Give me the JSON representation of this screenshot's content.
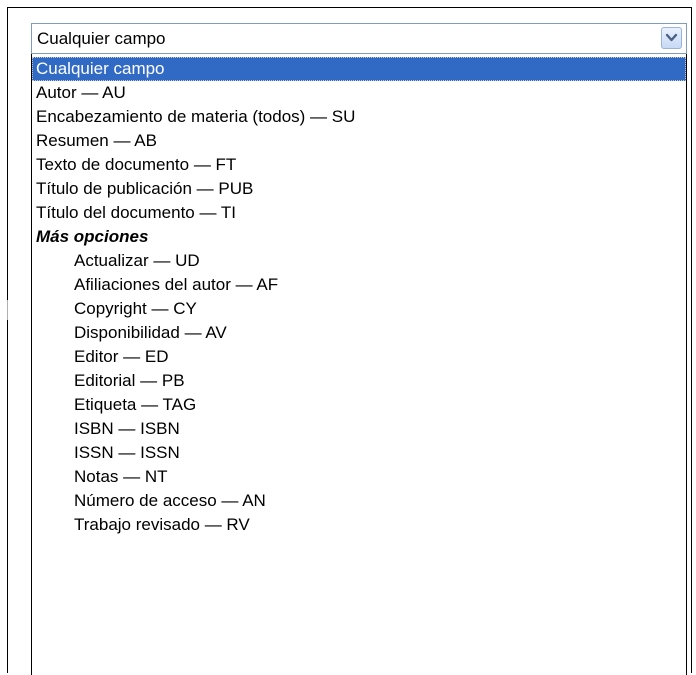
{
  "select": {
    "value": "Cualquier campo",
    "arrow_icon": "chevron-down-icon"
  },
  "options": {
    "cualquier_campo": "Cualquier campo",
    "autor": "Autor — AU",
    "encabezamiento": "Encabezamiento de materia (todos) — SU",
    "resumen": "Resumen — AB",
    "texto": "Texto de documento — FT",
    "titulo_publicacion": "Título de publicación — PUB",
    "titulo_documento": "Título del documento — TI"
  },
  "group": {
    "label": "Más opciones",
    "items": {
      "actualizar": "Actualizar — UD",
      "afiliaciones": "Afiliaciones del autor — AF",
      "copyright": "Copyright — CY",
      "disponibilidad": "Disponibilidad — AV",
      "editor": "Editor — ED",
      "editorial": "Editorial — PB",
      "etiqueta": "Etiqueta — TAG",
      "isbn": "ISBN — ISBN",
      "issn": "ISSN — ISSN",
      "notas": "Notas — NT",
      "numero_acceso": "Número de acceso — AN",
      "trabajo_revisado": "Trabajo revisado — RV"
    }
  },
  "colors": {
    "highlight": "#316ac5",
    "select_border": "#7f9db9"
  }
}
